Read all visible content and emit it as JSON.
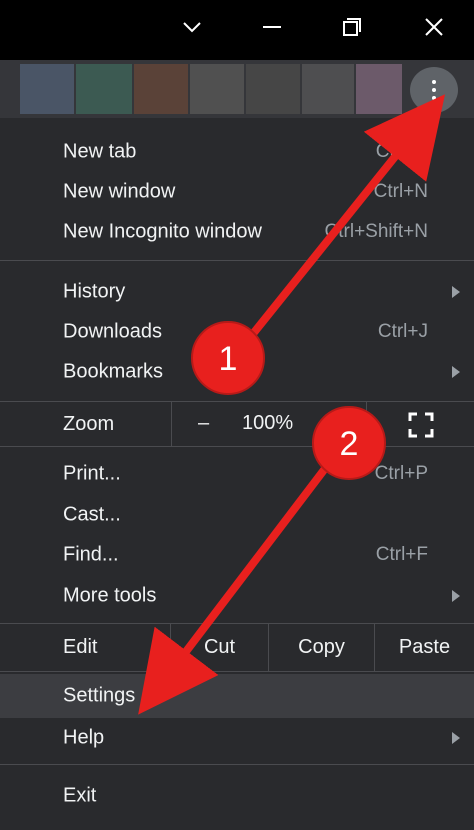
{
  "window_controls": {
    "dropdown_icon": "chevron-down-icon",
    "minimize_icon": "minimize-icon",
    "restore_icon": "restore-icon",
    "close_icon": "close-icon"
  },
  "toolbar": {
    "swatches": [
      "#4a5566",
      "#3c5a52",
      "#5a4238",
      "#505050",
      "#464646",
      "#4e4e50",
      "#6c5a6a"
    ],
    "menu_icon": "kebab-menu-icon"
  },
  "menu": {
    "new_tab": {
      "label": "New tab",
      "shortcut": "Ctrl+T"
    },
    "new_window": {
      "label": "New window",
      "shortcut": "Ctrl+N"
    },
    "new_incognito": {
      "label": "New Incognito window",
      "shortcut": "Ctrl+Shift+N"
    },
    "history": {
      "label": "History"
    },
    "downloads": {
      "label": "Downloads",
      "shortcut": "Ctrl+J"
    },
    "bookmarks": {
      "label": "Bookmarks"
    },
    "zoom": {
      "label": "Zoom",
      "minus": "–",
      "value": "100%",
      "plus": "+",
      "fullscreen_icon": "fullscreen-icon"
    },
    "print": {
      "label": "Print...",
      "shortcut": "Ctrl+P"
    },
    "cast": {
      "label": "Cast..."
    },
    "find": {
      "label": "Find...",
      "shortcut": "Ctrl+F"
    },
    "more_tools": {
      "label": "More tools"
    },
    "edit": {
      "label": "Edit",
      "cut": "Cut",
      "copy": "Copy",
      "paste": "Paste"
    },
    "settings": {
      "label": "Settings"
    },
    "help": {
      "label": "Help"
    },
    "exit": {
      "label": "Exit"
    }
  },
  "annotations": {
    "step1": "1",
    "step2": "2",
    "color": "#e8201e"
  }
}
